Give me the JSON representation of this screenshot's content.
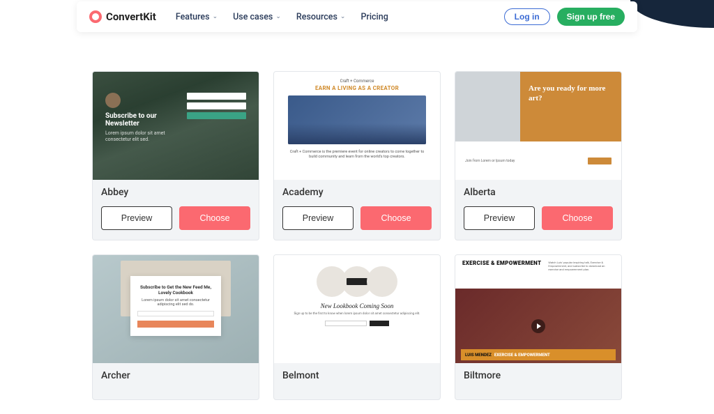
{
  "brand": "ConvertKit",
  "nav": {
    "items": [
      {
        "label": "Features",
        "has_dropdown": true
      },
      {
        "label": "Use cases",
        "has_dropdown": true
      },
      {
        "label": "Resources",
        "has_dropdown": true
      },
      {
        "label": "Pricing",
        "has_dropdown": false
      }
    ],
    "login": "Log in",
    "signup": "Sign up free"
  },
  "buttons": {
    "preview": "Preview",
    "choose": "Choose"
  },
  "templates": [
    {
      "name": "Abbey",
      "thumb": {
        "headline": "Subscribe to our Newsletter"
      }
    },
    {
      "name": "Academy",
      "thumb": {
        "tagline": "Craft + Commerce",
        "headline": "EARN A LIVING AS A CREATOR",
        "desc": "Craft + Commerce is the premiere event for online creators to come together to build community and learn from the world's top creators."
      }
    },
    {
      "name": "Alberta",
      "thumb": {
        "headline": "Are you ready for more art?"
      }
    },
    {
      "name": "Archer",
      "thumb": {
        "headline": "Subscribe to Get the New Feed Me, Lovely Cookbook"
      }
    },
    {
      "name": "Belmont",
      "thumb": {
        "headline": "New Lookbook Coming Soon"
      }
    },
    {
      "name": "Biltmore",
      "thumb": {
        "headline": "EXERCISE & EMPOWERMENT",
        "banner_a": "LUIS MENDEZ",
        "banner_b": "EXERCISE & EMPOWERMENT"
      }
    }
  ]
}
